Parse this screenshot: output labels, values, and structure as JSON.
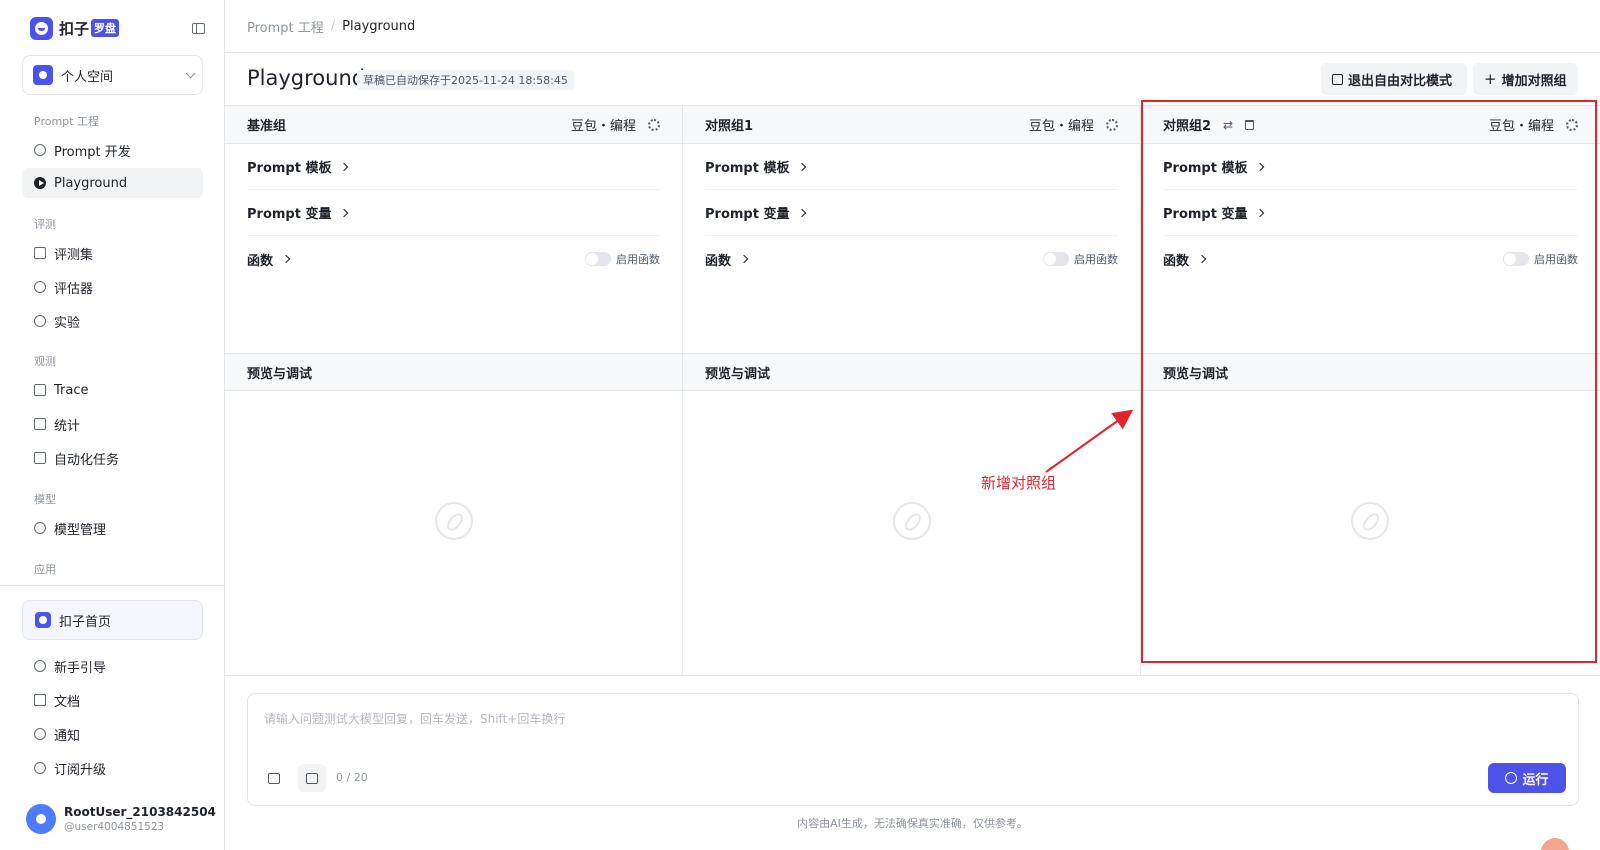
{
  "app": {
    "logo_text": "扣子",
    "logo_badge": "罗盘"
  },
  "sidebar": {
    "space": "个人空间",
    "groups": {
      "prompt": "Prompt 工程",
      "eval": "评测",
      "observe": "观测",
      "model": "模型",
      "app": "应用"
    },
    "items": {
      "prompt_dev": "Prompt 开发",
      "playground": "Playground",
      "eval_set": "评测集",
      "evaluator": "评估器",
      "experiment": "实验",
      "trace": "Trace",
      "stats": "统计",
      "auto_task": "自动化任务",
      "model_mgmt": "模型管理"
    },
    "home": "扣子首页",
    "bottom": {
      "guide": "新手引导",
      "docs": "文档",
      "notify": "通知",
      "upgrade": "订阅升级"
    },
    "user": {
      "name": "RootUser_2103842504",
      "id": "@user4004851523"
    }
  },
  "breadcrumb": {
    "parent": "Prompt 工程",
    "sep": "/",
    "current": "Playground"
  },
  "page": {
    "title": "Playground",
    "autosave": "草稿已自动保存于2025-11-24 18:58:45",
    "exit_button": "退出自由对比模式",
    "add_button": "增加对照组"
  },
  "columns": [
    {
      "title": "基准组",
      "model": "豆包・编程"
    },
    {
      "title": "对照组1",
      "model": "豆包・编程"
    },
    {
      "title": "对照组2",
      "model": "豆包・编程"
    }
  ],
  "rows": {
    "template": "Prompt 模板",
    "variables": "Prompt 变量",
    "functions": "函数",
    "enable_functions": "启用函数"
  },
  "preview_title": "预览与调试",
  "annotation": "新增对照组",
  "input": {
    "placeholder": "请输入问题测试大模型回复，回车发送，Shift+回车换行",
    "counter": "0 / 20",
    "run_button": "运行"
  },
  "disclaimer": "内容由AI生成，无法确保真实准确，仅供参考。",
  "colors": {
    "accent": "#4d53e8",
    "annotation_red": "#e0262c"
  }
}
